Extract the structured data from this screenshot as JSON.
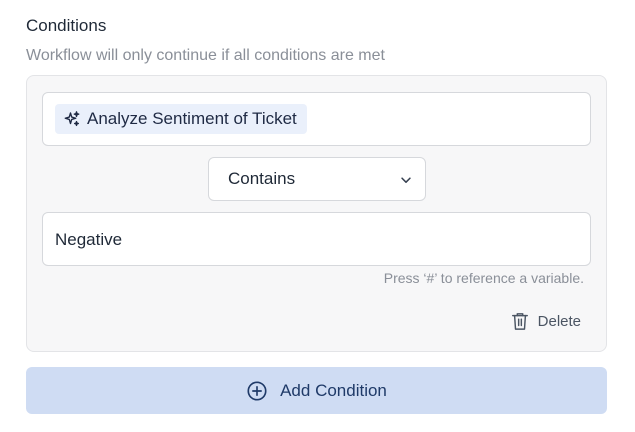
{
  "conditions": {
    "title": "Conditions",
    "subtitle": "Workflow will only continue if all conditions are met",
    "variable_field": {
      "chip_icon": "sparkle-icon",
      "chip_label": "Analyze Sentiment of Ticket"
    },
    "operator": {
      "selected": "Contains",
      "icon": "chevron-down-icon"
    },
    "value_field": {
      "value": "Negative",
      "helper_text": "Press ‘#’ to reference a variable."
    },
    "delete": {
      "label": "Delete",
      "icon": "trash-icon"
    },
    "add_condition": {
      "label": "Add Condition",
      "icon": "plus-circle-icon"
    },
    "colors": {
      "chip_bg": "#eaf0fb",
      "add_button_bg": "#cfdcf3",
      "add_button_text": "#1f3a68"
    }
  }
}
